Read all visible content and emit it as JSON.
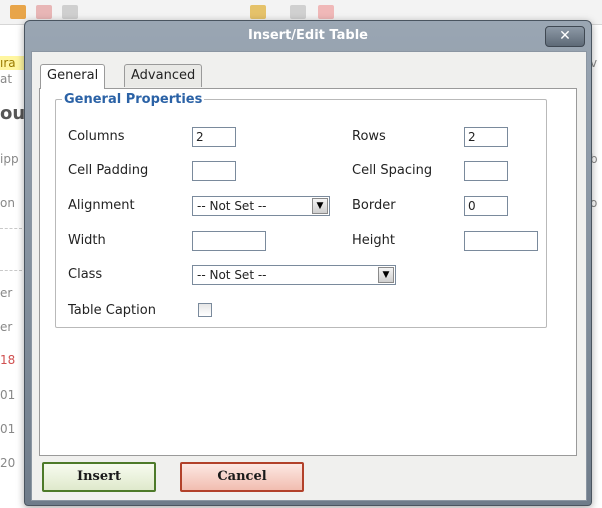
{
  "background": {
    "left_fragments": [
      "ıra",
      "at",
      "ou",
      "ipp",
      "on",
      "er",
      "er",
      "18",
      "01",
      "01",
      "20"
    ],
    "right_fragments": [
      "v",
      "b",
      "o"
    ]
  },
  "dialog": {
    "title": "Insert/Edit Table",
    "close_glyph": "✕",
    "tabs": [
      "General",
      "Advanced"
    ],
    "fieldset_legend": "General Properties",
    "fields": {
      "columns": {
        "label": "Columns",
        "value": "2"
      },
      "rows": {
        "label": "Rows",
        "value": "2"
      },
      "cell_padding": {
        "label": "Cell Padding",
        "value": ""
      },
      "cell_spacing": {
        "label": "Cell Spacing",
        "value": ""
      },
      "alignment": {
        "label": "Alignment",
        "value": "-- Not Set --"
      },
      "border": {
        "label": "Border",
        "value": "0"
      },
      "width": {
        "label": "Width",
        "value": ""
      },
      "height": {
        "label": "Height",
        "value": ""
      },
      "class": {
        "label": "Class",
        "value": "-- Not Set --"
      },
      "table_caption": {
        "label": "Table Caption",
        "checked": false
      }
    },
    "buttons": {
      "insert": "Insert",
      "cancel": "Cancel"
    },
    "dropdown_glyph": "▼"
  },
  "colors": {
    "legend": "#2b62a6",
    "insert_border": "#4d7a29",
    "cancel_border": "#b2412a",
    "titlebar": "#7b8794"
  }
}
